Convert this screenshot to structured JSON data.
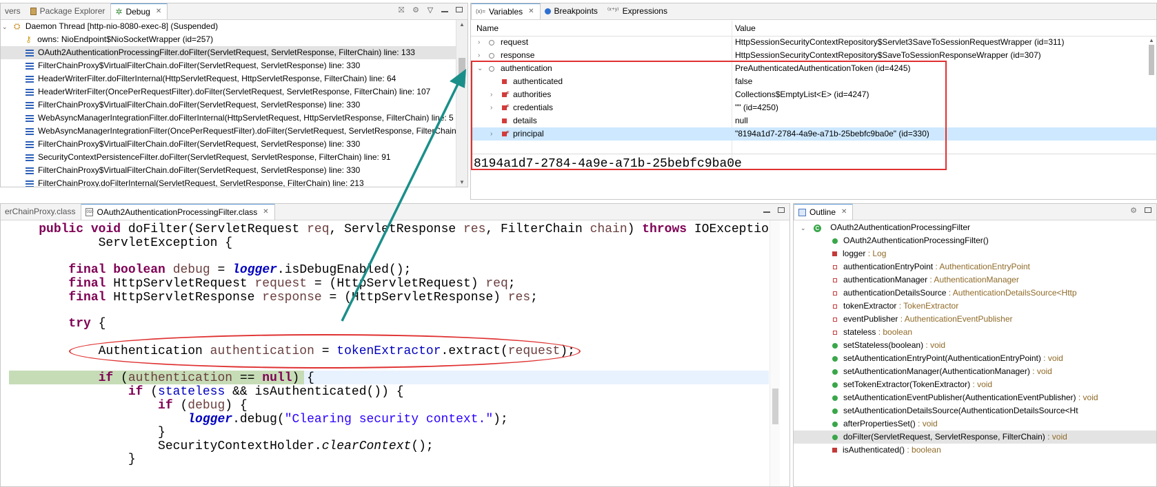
{
  "debug_view": {
    "tabs": [
      {
        "label": "vers"
      },
      {
        "label": "Package Explorer"
      },
      {
        "label": "Debug"
      }
    ],
    "thread": "Daemon Thread [http-nio-8080-exec-8] (Suspended)",
    "owns": "owns: NioEndpoint$NioSocketWrapper  (id=257)",
    "frames": [
      "OAuth2AuthenticationProcessingFilter.doFilter(ServletRequest, ServletResponse, FilterChain) line: 133",
      "FilterChainProxy$VirtualFilterChain.doFilter(ServletRequest, ServletResponse) line: 330",
      "HeaderWriterFilter.doFilterInternal(HttpServletRequest, HttpServletResponse, FilterChain) line: 64",
      "HeaderWriterFilter(OncePerRequestFilter).doFilter(ServletRequest, ServletResponse, FilterChain) line: 107",
      "FilterChainProxy$VirtualFilterChain.doFilter(ServletRequest, ServletResponse) line: 330",
      "WebAsyncManagerIntegrationFilter.doFilterInternal(HttpServletRequest, HttpServletResponse, FilterChain) line: 5",
      "WebAsyncManagerIntegrationFilter(OncePerRequestFilter).doFilter(ServletRequest, ServletResponse, FilterChain)",
      "FilterChainProxy$VirtualFilterChain.doFilter(ServletRequest, ServletResponse) line: 330",
      "SecurityContextPersistenceFilter.doFilter(ServletRequest, ServletResponse, FilterChain) line: 91",
      "FilterChainProxy$VirtualFilterChain.doFilter(ServletRequest, ServletResponse) line: 330",
      "FilterChainProxy.doFilterInternal(ServletRequest, ServletResponse, FilterChain) line: 213"
    ]
  },
  "variables_view": {
    "tabs": [
      {
        "label": "Variables",
        "prefix": "(x)="
      },
      {
        "label": "Breakpoints"
      },
      {
        "label": "Expressions"
      }
    ],
    "columns": {
      "name": "Name",
      "value": "Value"
    },
    "rows": [
      {
        "name": "request",
        "value": "HttpSessionSecurityContextRepository$Servlet3SaveToSessionRequestWrapper  (id=311)"
      },
      {
        "name": "response",
        "value": "HttpSessionSecurityContextRepository$SaveToSessionResponseWrapper  (id=307)"
      },
      {
        "name": "authentication",
        "value": "PreAuthenticatedAuthenticationToken  (id=4245)"
      },
      {
        "name": "authenticated",
        "value": "false"
      },
      {
        "name": "authorities",
        "value": "Collections$EmptyList<E>  (id=4247)"
      },
      {
        "name": "credentials",
        "value": "\"\" (id=4250)"
      },
      {
        "name": "details",
        "value": "null"
      },
      {
        "name": "principal",
        "value": "\"8194a1d7-2784-4a9e-a71b-25bebfc9ba0e\" (id=330)"
      }
    ],
    "detail": "8194a1d7-2784-4a9e-a71b-25bebfc9ba0e"
  },
  "editor": {
    "tabs": [
      {
        "label": "erChainProxy.class"
      },
      {
        "label": "OAuth2AuthenticationProcessingFilter.class"
      }
    ],
    "tokens": {
      "public": "public",
      "void": "void",
      "doFilter": "doFilter(",
      "ServletRequest": "ServletRequest ",
      "req": "req",
      "comma1": ", ",
      "ServletResponse": "ServletResponse ",
      "res": "res",
      "FilterChain": "FilterChain ",
      "chain": "chain",
      "close1": ") ",
      "throws": "throws",
      "IOException": " IOException,",
      "ServletException": "ServletException {",
      "final": "final",
      "boolean": "boolean",
      "debug": "debug",
      "eq": " = ",
      "logger": "logger",
      "isDebugEnabled": ".isDebugEnabled();",
      "HttpServletRequest": " HttpServletRequest ",
      "request": "request",
      "castReq": " = (HttpServletRequest) ",
      "semi": ";",
      "HttpServletResponse": " HttpServletResponse ",
      "response": "response",
      "castRes": " = (HttpServletResponse) ",
      "try": "try",
      "brace": " {",
      "Authentication": "Authentication ",
      "authentication": "authentication",
      "tokenExtractor": "tokenExtractor",
      "extract": ".extract(",
      "closeSemi": ");",
      "if": "if",
      "open": " (",
      "eqnull": " == ",
      "null": "null",
      "closeBrace": ") {",
      "stateless": "stateless",
      "and": " && isAuthenticated()) {",
      "debugCall": ".debug(",
      "clearing": "\"Clearing security context.\"",
      "closeBraceSolo": "}",
      "SecurityContextHolder": "SecurityContextHolder.",
      "clearContext": "clearContext",
      "callEnd": "();",
      "trailing": "}"
    }
  },
  "outline_view": {
    "tab": "Outline",
    "class_name": "OAuth2AuthenticationProcessingFilter",
    "members": [
      {
        "name": "OAuth2AuthenticationProcessingFilter()",
        "type": "",
        "kind": "ctor"
      },
      {
        "name": "logger",
        "type": " : Log",
        "kind": "sfield"
      },
      {
        "name": "authenticationEntryPoint",
        "type": " : AuthenticationEntryPoint",
        "kind": "field"
      },
      {
        "name": "authenticationManager",
        "type": " : AuthenticationManager",
        "kind": "field"
      },
      {
        "name": "authenticationDetailsSource",
        "type": " : AuthenticationDetailsSource<Http",
        "kind": "field"
      },
      {
        "name": "tokenExtractor",
        "type": " : TokenExtractor",
        "kind": "field"
      },
      {
        "name": "eventPublisher",
        "type": " : AuthenticationEventPublisher",
        "kind": "field"
      },
      {
        "name": "stateless",
        "type": " : boolean",
        "kind": "field"
      },
      {
        "name": "setStateless(boolean)",
        "type": " : void",
        "kind": "method"
      },
      {
        "name": "setAuthenticationEntryPoint(AuthenticationEntryPoint)",
        "type": " : void",
        "kind": "method"
      },
      {
        "name": "setAuthenticationManager(AuthenticationManager)",
        "type": " : void",
        "kind": "method"
      },
      {
        "name": "setTokenExtractor(TokenExtractor)",
        "type": " : void",
        "kind": "method"
      },
      {
        "name": "setAuthenticationEventPublisher(AuthenticationEventPublisher)",
        "type": " : void",
        "kind": "method"
      },
      {
        "name": "setAuthenticationDetailsSource(AuthenticationDetailsSource<Ht",
        "type": "",
        "kind": "method"
      },
      {
        "name": "afterPropertiesSet()",
        "type": " : void",
        "kind": "method"
      },
      {
        "name": "doFilter(ServletRequest, ServletResponse, FilterChain)",
        "type": " : void",
        "kind": "method"
      },
      {
        "name": "isAuthenticated()",
        "type": " : boolean",
        "kind": "private"
      }
    ]
  },
  "annotation_colors": {
    "box": "#e03030",
    "arrow": "#1a8f8a"
  }
}
